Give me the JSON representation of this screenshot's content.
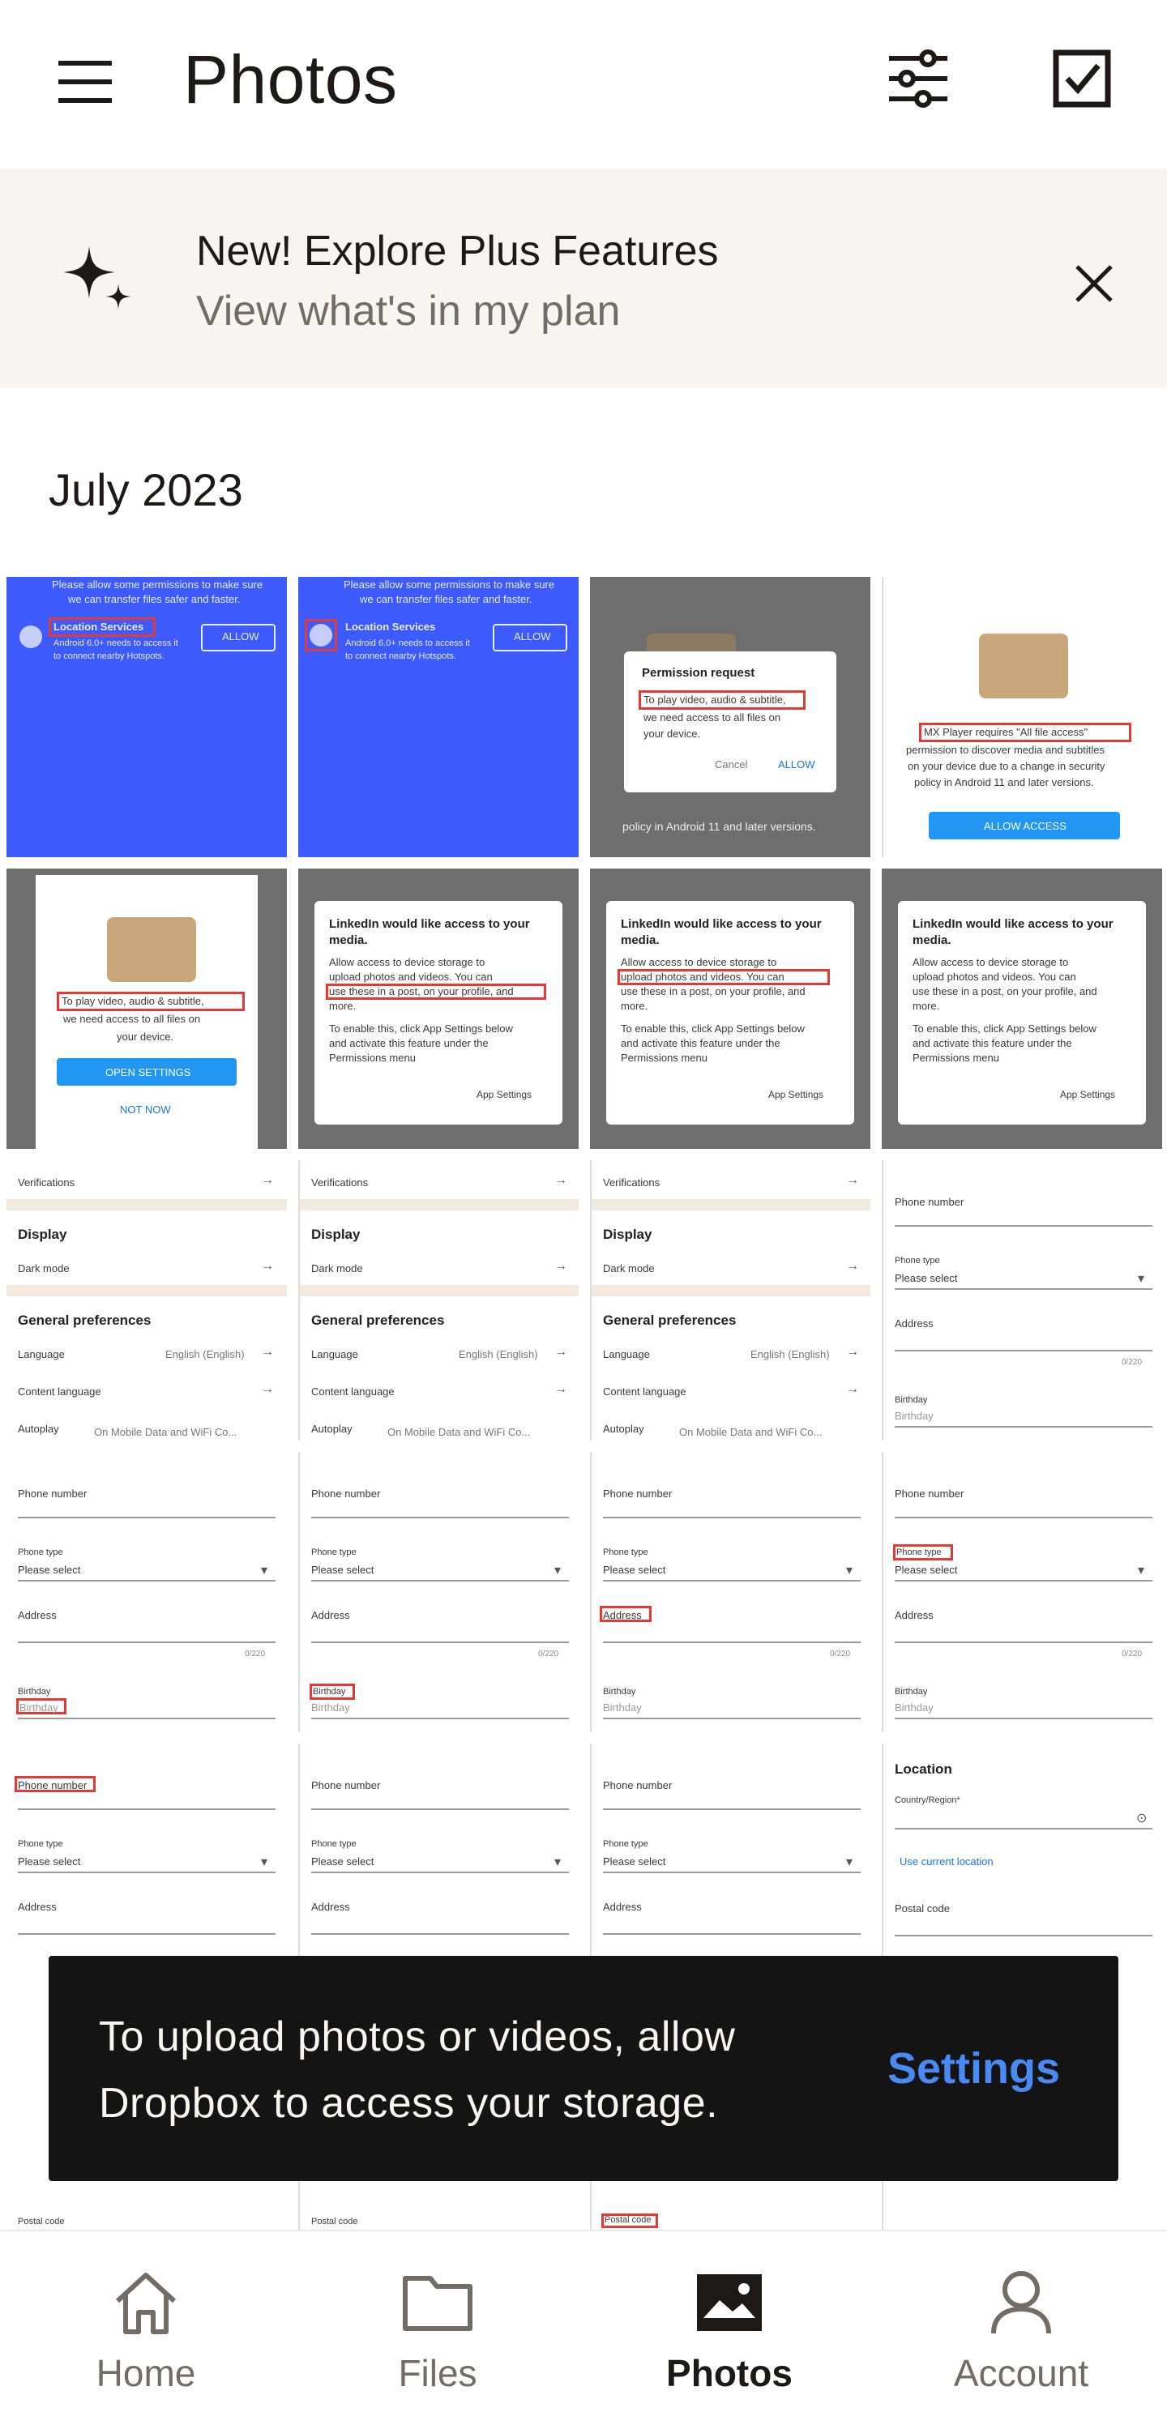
{
  "appbar": {
    "title": "Photos",
    "menu_icon": "hamburger-menu-icon",
    "filter_icon": "sliders-icon",
    "select_icon": "checkbox-icon"
  },
  "promo": {
    "headline": "New! Explore Plus Features",
    "subtext": "View what's in my plan",
    "icon": "sparkle-icon",
    "close_icon": "close-icon"
  },
  "section": {
    "title": "July 2023"
  },
  "thumbnails": {
    "location_title": "Location Services",
    "location_top": "Please allow some permissions to make sure",
    "location_top2": "we can transfer files safer and faster.",
    "location_body": "Android 6.0+ needs to access it",
    "location_body2": "to connect nearby Hotspots.",
    "allow": "ALLOW",
    "permission_title": "Permission request",
    "permission_body": "To play video, audio & subtitle,",
    "permission_body2": "we need access to all files on",
    "permission_body3": "your device.",
    "cancel": "Cancel",
    "allow_lower": "ALLOW",
    "allow_access": "ALLOW ACCESS",
    "mx_line1": "MX Player requires \"All file access\"",
    "mx_line2": "permission to discover media and subtitles",
    "mx_line3": "on your device due to a change in security",
    "mx_line4": "policy in Android 11 and later versions.",
    "open_settings": "OPEN SETTINGS",
    "not_now": "NOT NOW",
    "li_title1": "LinkedIn would like access to your",
    "li_title2": "media.",
    "li_body1": "Allow access to device storage to",
    "li_body2": "upload photos and videos. You can",
    "li_body3": "use these in a post, on your profile, and",
    "li_body4": "more.",
    "li_body5": "To enable this, click App Settings below",
    "li_body6": "and activate this feature under the",
    "li_body7": "Permissions menu",
    "app_settings": "App Settings",
    "verifications": "Verifications",
    "display": "Display",
    "dark_mode": "Dark mode",
    "general_prefs": "General preferences",
    "language": "Language",
    "language_val": "English (English)",
    "content_language": "Content language",
    "autoplay": "Autoplay",
    "autoplay_val": "On Mobile Data and WiFi Co...",
    "phone_number": "Phone number",
    "phone_type": "Phone type",
    "please_select": "Please select",
    "address": "Address",
    "counter": "0/220",
    "birthday": "Birthday",
    "location": "Location",
    "country": "Country/Region*",
    "use_current": "Use current location",
    "postal_code": "Postal code"
  },
  "snackbar": {
    "line1": "To upload photos or videos, allow",
    "line2": "Dropbox to access your storage.",
    "action": "Settings"
  },
  "bottom_nav": {
    "items": [
      {
        "label": "Home",
        "icon": "home-icon"
      },
      {
        "label": "Files",
        "icon": "folder-icon"
      },
      {
        "label": "Photos",
        "icon": "photos-icon",
        "active": true
      },
      {
        "label": "Account",
        "icon": "account-icon"
      }
    ]
  },
  "colors": {
    "accent": "#4a8af4",
    "banner_bg": "#f7f5f2",
    "snackbar_bg": "#141414",
    "text_primary": "#1e1919",
    "text_secondary": "#736c64",
    "thumb_blue": "#3d5afe"
  }
}
